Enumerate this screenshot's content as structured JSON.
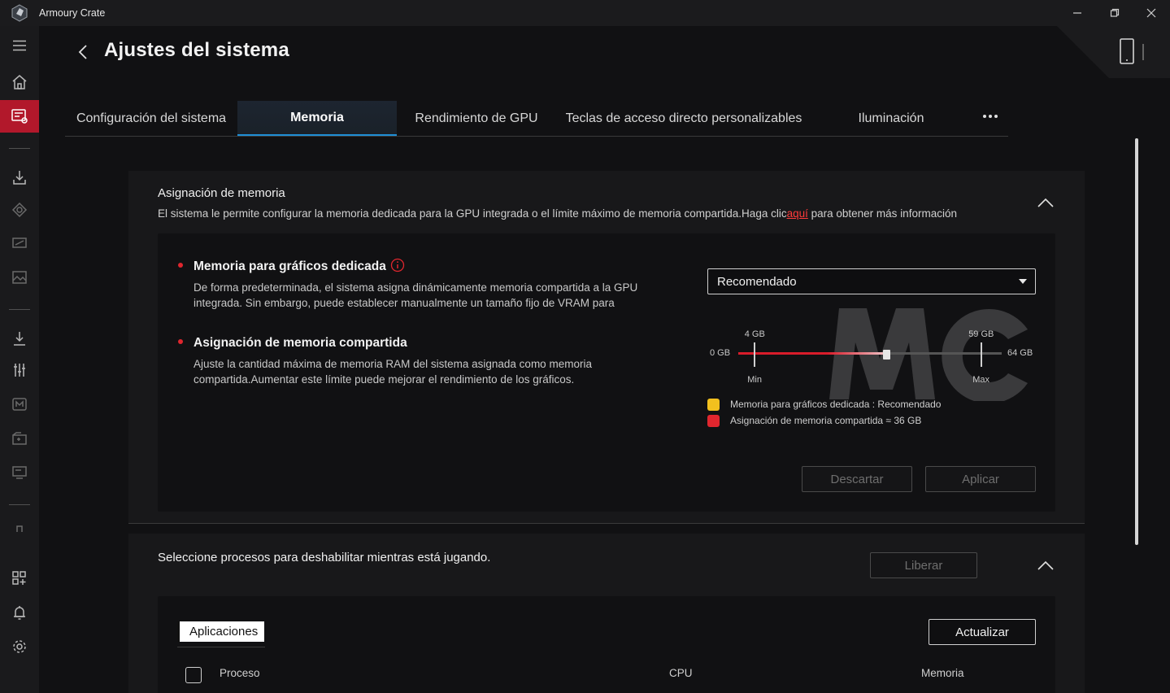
{
  "window": {
    "title": "Armoury Crate"
  },
  "header": {
    "title": "Ajustes del sistema"
  },
  "tabs": [
    {
      "label": "Configuración del sistema"
    },
    {
      "label": "Memoria"
    },
    {
      "label": "Rendimiento de GPU"
    },
    {
      "label": "Teclas de acceso directo personalizables"
    },
    {
      "label": "Iluminación"
    }
  ],
  "active_tab": "Memoria",
  "memory_section": {
    "title": "Asignación de memoria",
    "desc_before": "El sistema le permite configurar la memoria dedicada para la GPU integrada o el límite máximo de memoria compartida.Haga clic",
    "desc_link": "aquí",
    "desc_after": " para obtener más información",
    "dedicated": {
      "title": "Memoria para gráficos dedicada",
      "desc": "De forma predeterminada, el sistema asigna dinámicamente memoria compartida a la GPU integrada. Sin embargo, puede establecer manualmente un tamaño fijo de VRAM para"
    },
    "shared": {
      "title": "Asignación de memoria compartida",
      "desc": "Ajuste la cantidad máxima de memoria RAM del sistema asignada como memoria compartida.Aumentar este límite puede mejorar el rendimiento de los gráficos."
    },
    "dropdown_value": "Recomendado",
    "slider": {
      "min_label": "0 GB",
      "max_label": "64 GB",
      "low_mark_value": "4 GB",
      "low_mark_caption": "Min",
      "high_mark_value": "59 GB",
      "high_mark_caption": "Max",
      "range_gb": 64,
      "low_mark_gb": 4,
      "high_mark_gb": 59,
      "current_gb": 36
    },
    "legend": [
      {
        "label": "Memoria para gráficos dedicada : Recomendado",
        "color": "#f2c01e"
      },
      {
        "label": "Asignación de memoria compartida ≈ 36 GB",
        "color": "#e0262e"
      }
    ],
    "discard_label": "Descartar",
    "apply_label": "Aplicar"
  },
  "process_section": {
    "title": "Seleccione procesos para deshabilitar mientras está jugando.",
    "release_label": "Liberar",
    "apps_tab_label": "Aplicaciones",
    "refresh_label": "Actualizar",
    "columns": [
      "Proceso",
      "CPU",
      "Memoria"
    ]
  },
  "colors": {
    "accent_red": "#e0262e",
    "sidebar_active": "#b2182b",
    "tab_underline": "#1f8fd6"
  }
}
